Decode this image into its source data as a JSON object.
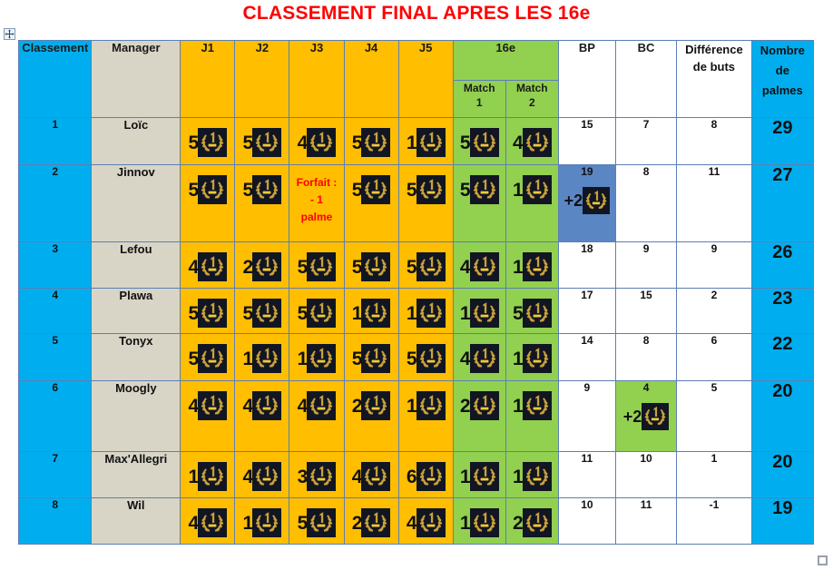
{
  "title": "CLASSEMENT FINAL APRES LES 16e",
  "colors": {
    "title": "#FF0000",
    "header_blue": "#00AEEF",
    "header_beige": "#D9D5C6",
    "header_orange": "#FFBE00",
    "header_green": "#92D050",
    "highlight_blue": "#5B86C4",
    "highlight_green": "#92D050",
    "badge_bg": "#111622",
    "badge_gold": "#C9A13B",
    "grid_line": "#5B7FB4"
  },
  "icons": {
    "move_handle": "move-handle-icon",
    "resize_handle": "resize-handle-icon",
    "palme": "palme-laurel-badge-icon"
  },
  "header": {
    "rank": "Classement",
    "manager": "Manager",
    "j1": "J1",
    "j2": "J2",
    "j3": "J3",
    "j4": "J4",
    "j5": "J5",
    "seize": "16e",
    "match1_l1": "Match",
    "match1_l2": "1",
    "match2_l1": "Match",
    "match2_l2": "2",
    "bp": "BP",
    "bc": "BC",
    "diff_l1": "Différence",
    "diff_l2": "de buts",
    "palmes_l1": "Nombre",
    "palmes_l2": "de",
    "palmes_l3": "palmes"
  },
  "rows": [
    {
      "rank": "1",
      "manager": "Loïc",
      "j1": "5",
      "j2": "5",
      "j3": "4",
      "j4": "5",
      "j5": "1",
      "m1": "5",
      "m2": "4",
      "bp": "15",
      "bc": "7",
      "diff": "8",
      "palmes": "29",
      "j3_forfait": null,
      "bp_bonus": null,
      "bc_bonus": null,
      "bp_hl": null,
      "bc_hl": null
    },
    {
      "rank": "2",
      "manager": "Jinnov",
      "j1": "5",
      "j2": "5",
      "j3": null,
      "j4": "5",
      "j5": "5",
      "m1": "5",
      "m2": "1",
      "bp": "19",
      "bc": "8",
      "diff": "11",
      "palmes": "27",
      "j3_forfait": "Forfait :\n- 1\npalme",
      "bp_bonus": "+2",
      "bc_bonus": null,
      "bp_hl": "#5B86C4",
      "bc_hl": null
    },
    {
      "rank": "3",
      "manager": "Lefou",
      "j1": "4",
      "j2": "2",
      "j3": "5",
      "j4": "5",
      "j5": "5",
      "m1": "4",
      "m2": "1",
      "bp": "18",
      "bc": "9",
      "diff": "9",
      "palmes": "26",
      "j3_forfait": null,
      "bp_bonus": null,
      "bc_bonus": null,
      "bp_hl": null,
      "bc_hl": null
    },
    {
      "rank": "4",
      "manager": "Plawa",
      "j1": "5",
      "j2": "5",
      "j3": "5",
      "j4": "1",
      "j5": "1",
      "m1": "1",
      "m2": "5",
      "bp": "17",
      "bc": "15",
      "diff": "2",
      "palmes": "23",
      "j3_forfait": null,
      "bp_bonus": null,
      "bc_bonus": null,
      "bp_hl": null,
      "bc_hl": null
    },
    {
      "rank": "5",
      "manager": "Tonyx",
      "j1": "5",
      "j2": "1",
      "j3": "1",
      "j4": "5",
      "j5": "5",
      "m1": "4",
      "m2": "1",
      "bp": "14",
      "bc": "8",
      "diff": "6",
      "palmes": "22",
      "j3_forfait": null,
      "bp_bonus": null,
      "bc_bonus": null,
      "bp_hl": null,
      "bc_hl": null
    },
    {
      "rank": "6",
      "manager": "Moogly",
      "j1": "4",
      "j2": "4",
      "j3": "4",
      "j4": "2",
      "j5": "1",
      "m1": "2",
      "m2": "1",
      "bp": "9",
      "bc": "4",
      "diff": "5",
      "palmes": "20",
      "j3_forfait": null,
      "bp_bonus": null,
      "bc_bonus": "+2",
      "bp_hl": null,
      "bc_hl": "#92D050"
    },
    {
      "rank": "7",
      "manager": "Max'Allegri",
      "j1": "1",
      "j2": "4",
      "j3": "3",
      "j4": "4",
      "j5": "6",
      "m1": "1",
      "m2": "1",
      "bp": "11",
      "bc": "10",
      "diff": "1",
      "palmes": "20",
      "j3_forfait": null,
      "bp_bonus": null,
      "bc_bonus": null,
      "bp_hl": null,
      "bc_hl": null
    },
    {
      "rank": "8",
      "manager": "Wil",
      "j1": "4",
      "j2": "1",
      "j3": "5",
      "j4": "2",
      "j5": "4",
      "m1": "1",
      "m2": "2",
      "bp": "10",
      "bc": "11",
      "diff": "-1",
      "palmes": "19",
      "j3_forfait": null,
      "bp_bonus": null,
      "bc_bonus": null,
      "bp_hl": null,
      "bc_hl": null
    }
  ]
}
